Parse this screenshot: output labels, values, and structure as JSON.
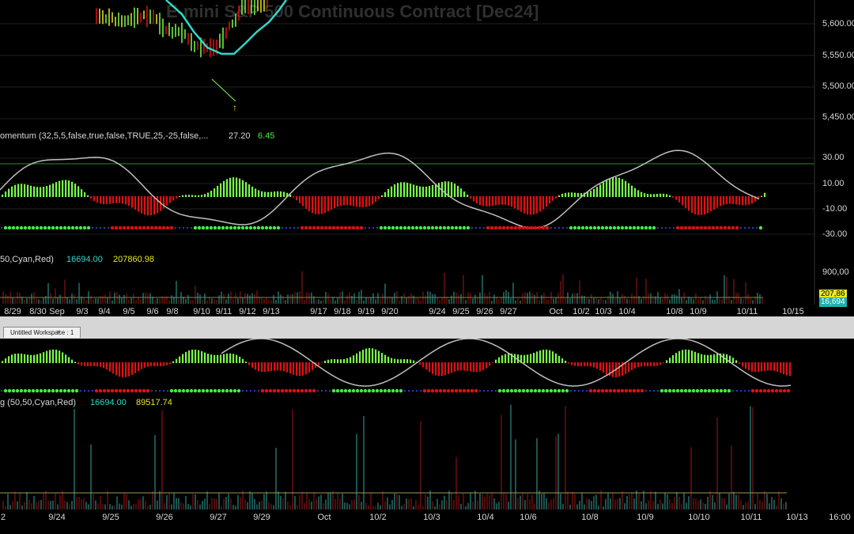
{
  "top_chart": {
    "watermark": "E-mini S&P 500 Continuous Contract [Dec24]",
    "price_axis": [
      "5,600.00",
      "5,550.00",
      "5,500.00",
      "5,450.00"
    ],
    "momentum_label": "omentum (32,5,5,false,true,false,TRUE,25,-25,false,...",
    "momentum_value1": "27.20",
    "momentum_value2": "6.45",
    "momentum_axis": [
      "30.00",
      "10.00",
      "-10.00",
      "-30.00"
    ],
    "volume_label": "50,Cyan,Red)",
    "volume_value1": "16694.00",
    "volume_value2": "207860.98",
    "volume_axis": [
      "900,00"
    ],
    "volume_tag1": "207,86",
    "volume_tag2": "16,694",
    "dates": [
      "8/29",
      "8/30",
      "Sep",
      "9/3",
      "9/4",
      "9/5",
      "9/6",
      "9/8",
      "9/10",
      "9/11",
      "9/12",
      "9/13",
      "9/17",
      "9/18",
      "9/19",
      "9/20",
      "9/24",
      "9/25",
      "9/26",
      "9/27",
      "Oct",
      "10/2",
      "10/3",
      "10/4",
      "10/8",
      "10/9",
      "10/11",
      "10/15"
    ]
  },
  "workspace_tab": {
    "label": "Untitled Workspace : 1",
    "close": "×"
  },
  "bottom_chart": {
    "volume_label": "g (50,50,Cyan,Red)",
    "volume_value1": "16694.00",
    "volume_value2": "89517.74",
    "dates": [
      "2",
      "9/24",
      "9/25",
      "9/26",
      "9/27",
      "9/29",
      "Oct",
      "10/2",
      "10/3",
      "10/4",
      "10/6",
      "10/8",
      "10/9",
      "10/10",
      "10/11",
      "10/13",
      "16:00"
    ]
  },
  "colors": {
    "up": "#7CFC4A",
    "down": "#E01010",
    "cyan": "#30D8C8",
    "gray_line": "#BFBFBF",
    "yellow": "#E8E820",
    "blue_dot": "#3050FF",
    "green_dot": "#40F040"
  }
}
